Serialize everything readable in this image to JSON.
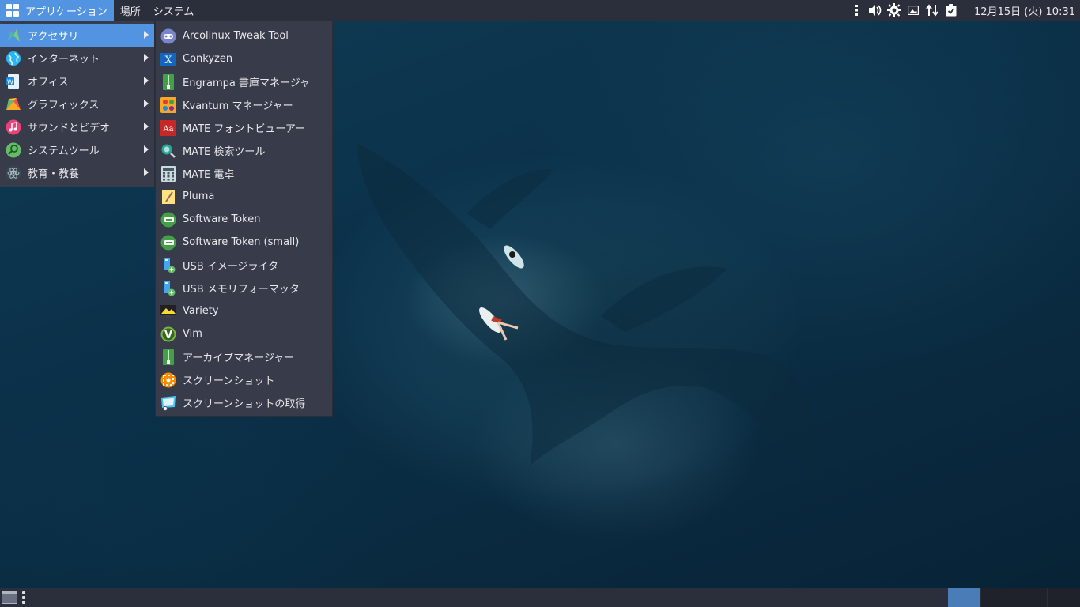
{
  "top_panel": {
    "menus": [
      {
        "label": "アプリケーション"
      },
      {
        "label": "場所"
      },
      {
        "label": "システム"
      }
    ],
    "clock": "12月15日 (火) 10:31",
    "tray_icons": [
      "volume-icon",
      "settings-gear-icon",
      "photo-icon",
      "network-transfer-icon",
      "clipboard-check-icon"
    ]
  },
  "main_menu": {
    "items": [
      {
        "label": "アクセサリ",
        "icon": "accessories-icon"
      },
      {
        "label": "インターネット",
        "icon": "internet-globe-icon"
      },
      {
        "label": "オフィス",
        "icon": "office-document-icon"
      },
      {
        "label": "グラフィックス",
        "icon": "graphics-icon"
      },
      {
        "label": "サウンドとビデオ",
        "icon": "music-note-icon"
      },
      {
        "label": "システムツール",
        "icon": "system-tools-icon"
      },
      {
        "label": "教育・教養",
        "icon": "atom-icon"
      }
    ]
  },
  "submenu": {
    "items": [
      {
        "label": "Arcolinux Tweak Tool"
      },
      {
        "label": "Conkyzen"
      },
      {
        "label": "Engrampa 書庫マネージャ"
      },
      {
        "label": "Kvantum マネージャー"
      },
      {
        "label": "MATE フォントビューアー"
      },
      {
        "label": "MATE 検索ツール"
      },
      {
        "label": "MATE 電卓"
      },
      {
        "label": "Pluma"
      },
      {
        "label": "Software Token"
      },
      {
        "label": "Software Token (small)"
      },
      {
        "label": "USB イメージライタ"
      },
      {
        "label": "USB メモリフォーマッタ"
      },
      {
        "label": "Variety"
      },
      {
        "label": "Vim"
      },
      {
        "label": "アーカイブマネージャー"
      },
      {
        "label": "スクリーンショット"
      },
      {
        "label": "スクリーンショットの取得"
      }
    ]
  },
  "colors": {
    "panel_bg": "#2b2e3b",
    "menu_bg": "#383c4a",
    "accent": "#5294e2"
  }
}
